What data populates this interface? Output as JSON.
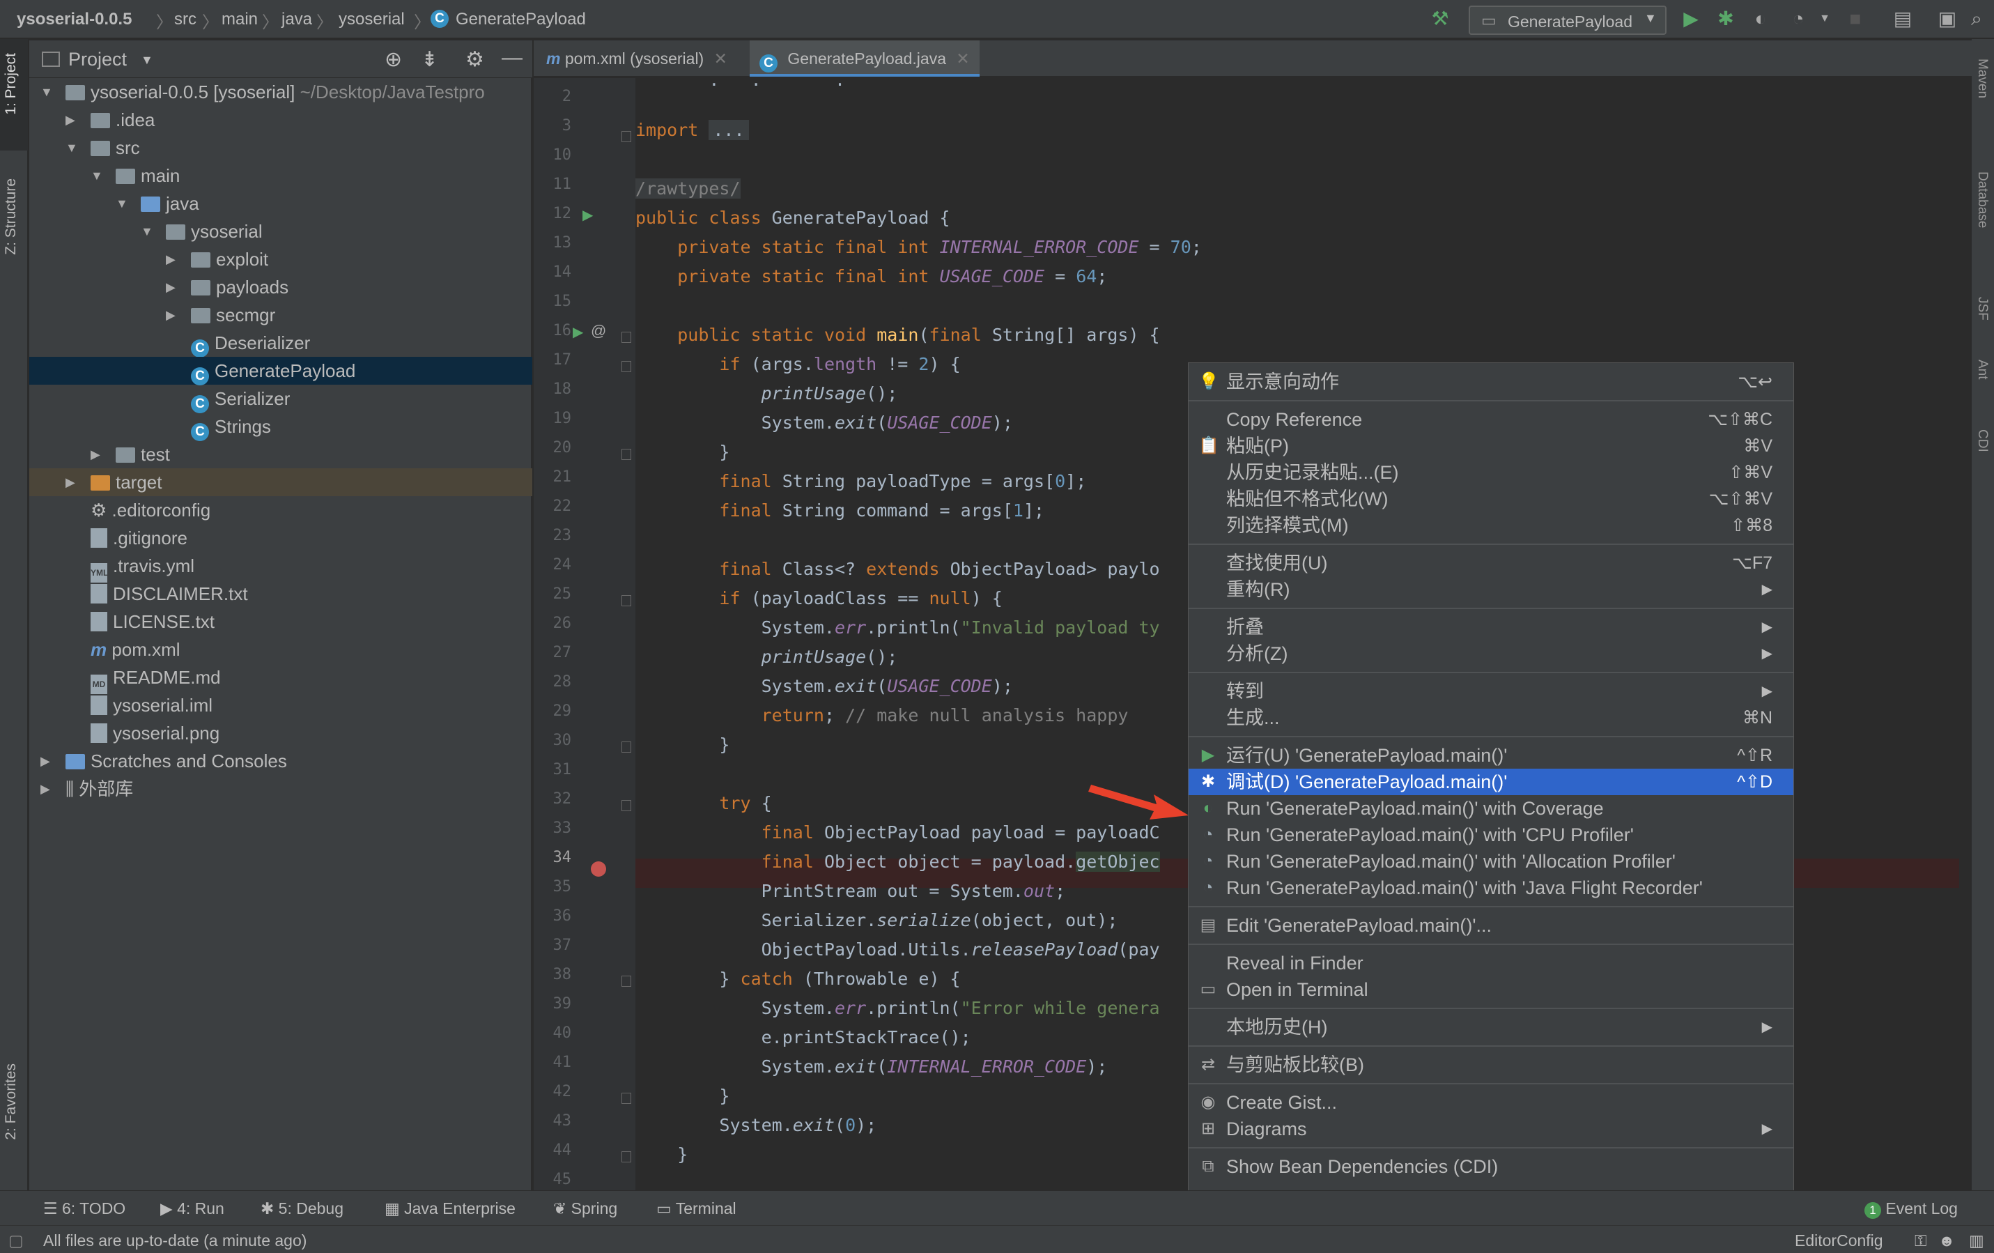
{
  "navbar": {
    "crumbs": [
      "ysoserial-0.0.5",
      "src",
      "main",
      "java",
      "ysoserial",
      "GeneratePayload"
    ],
    "run_config": "GeneratePayload"
  },
  "left_strip": {
    "project": "1: Project",
    "structure": "Z: Structure",
    "favorites": "2: Favorites"
  },
  "right_strip": {
    "maven": "Maven",
    "database": "Database",
    "jsf": "JSF",
    "ant": "Ant",
    "cdi": "CDI"
  },
  "project_panel": {
    "title": "Project",
    "tree": [
      {
        "label": "ysoserial-0.0.5 [ysoserial]",
        "extra": "~/Desktop/JavaTestpro",
        "depth": 0,
        "arrow": "down",
        "icon": "folder"
      },
      {
        "label": ".idea",
        "depth": 1,
        "arrow": "right",
        "icon": "folder"
      },
      {
        "label": "src",
        "depth": 1,
        "arrow": "down",
        "icon": "folder"
      },
      {
        "label": "main",
        "depth": 2,
        "arrow": "down",
        "icon": "folder"
      },
      {
        "label": "java",
        "depth": 3,
        "arrow": "down",
        "icon": "folder-blue"
      },
      {
        "label": "ysoserial",
        "depth": 4,
        "arrow": "down",
        "icon": "package"
      },
      {
        "label": "exploit",
        "depth": 5,
        "arrow": "right",
        "icon": "package"
      },
      {
        "label": "payloads",
        "depth": 5,
        "arrow": "right",
        "icon": "package"
      },
      {
        "label": "secmgr",
        "depth": 5,
        "arrow": "right",
        "icon": "package"
      },
      {
        "label": "Deserializer",
        "depth": 5,
        "arrow": "",
        "icon": "class"
      },
      {
        "label": "GeneratePayload",
        "depth": 5,
        "arrow": "",
        "icon": "class",
        "selected": true
      },
      {
        "label": "Serializer",
        "depth": 5,
        "arrow": "",
        "icon": "class"
      },
      {
        "label": "Strings",
        "depth": 5,
        "arrow": "",
        "icon": "class"
      },
      {
        "label": "test",
        "depth": 2,
        "arrow": "right",
        "icon": "folder"
      },
      {
        "label": "target",
        "depth": 1,
        "arrow": "right",
        "icon": "folder-orange",
        "target": true
      },
      {
        "label": ".editorconfig",
        "depth": 1,
        "arrow": "",
        "icon": "gear-file"
      },
      {
        "label": ".gitignore",
        "depth": 1,
        "arrow": "",
        "icon": "file"
      },
      {
        "label": ".travis.yml",
        "depth": 1,
        "arrow": "",
        "icon": "yml-file"
      },
      {
        "label": "DISCLAIMER.txt",
        "depth": 1,
        "arrow": "",
        "icon": "file"
      },
      {
        "label": "LICENSE.txt",
        "depth": 1,
        "arrow": "",
        "icon": "file"
      },
      {
        "label": "pom.xml",
        "depth": 1,
        "arrow": "",
        "icon": "maven-file"
      },
      {
        "label": "README.md",
        "depth": 1,
        "arrow": "",
        "icon": "md-file"
      },
      {
        "label": "ysoserial.iml",
        "depth": 1,
        "arrow": "",
        "icon": "file"
      },
      {
        "label": "ysoserial.png",
        "depth": 1,
        "arrow": "",
        "icon": "file"
      },
      {
        "label": "Scratches and Consoles",
        "depth": 0,
        "arrow": "right",
        "icon": "scratch"
      },
      {
        "label": "外部库",
        "depth": 0,
        "arrow": "right",
        "icon": "library"
      }
    ]
  },
  "tabs": [
    {
      "label": "pom.xml (ysoserial)",
      "icon": "m",
      "active": false
    },
    {
      "label": "GeneratePayload.java",
      "icon": "c",
      "active": true
    }
  ],
  "line_numbers": [
    "2",
    "3",
    "10",
    "11",
    "12",
    "13",
    "14",
    "15",
    "16",
    "17",
    "18",
    "19",
    "20",
    "21",
    "22",
    "23",
    "24",
    "25",
    "26",
    "27",
    "28",
    "29",
    "30",
    "31",
    "32",
    "33",
    "34",
    "35",
    "36",
    "37",
    "38",
    "39",
    "40",
    "41",
    "42",
    "43",
    "44",
    "45"
  ],
  "context_menu": {
    "items": [
      {
        "label": "显示意向动作",
        "shortcut": "⌥↩",
        "icon": "bulb"
      },
      {
        "sep": true
      },
      {
        "label": "Copy Reference",
        "shortcut": "⌥⇧⌘C"
      },
      {
        "label": "粘贴(P)",
        "shortcut": "⌘V",
        "icon": "clipboard"
      },
      {
        "label": "从历史记录粘贴...(E)",
        "shortcut": "⇧⌘V"
      },
      {
        "label": "粘贴但不格式化(W)",
        "shortcut": "⌥⇧⌘V"
      },
      {
        "label": "列选择模式(M)",
        "shortcut": "⇧⌘8"
      },
      {
        "sep": true
      },
      {
        "label": "查找使用(U)",
        "shortcut": "⌥F7"
      },
      {
        "label": "重构(R)",
        "submenu": true
      },
      {
        "sep": true
      },
      {
        "label": "折叠",
        "submenu": true
      },
      {
        "label": "分析(Z)",
        "submenu": true
      },
      {
        "sep": true
      },
      {
        "label": "转到",
        "submenu": true
      },
      {
        "label": "生成...",
        "shortcut": "⌘N"
      },
      {
        "sep": true
      },
      {
        "label": "运行(U) 'GeneratePayload.main()'",
        "shortcut": "^⇧R",
        "icon": "run"
      },
      {
        "label": "调试(D) 'GeneratePayload.main()'",
        "shortcut": "^⇧D",
        "icon": "debug",
        "highlighted": true
      },
      {
        "label": "Run 'GeneratePayload.main()' with Coverage",
        "icon": "coverage"
      },
      {
        "label": "Run 'GeneratePayload.main()' with 'CPU Profiler'",
        "icon": "profiler"
      },
      {
        "label": "Run 'GeneratePayload.main()' with 'Allocation Profiler'",
        "icon": "profiler"
      },
      {
        "label": "Run 'GeneratePayload.main()' with 'Java Flight Recorder'",
        "icon": "profiler"
      },
      {
        "sep": true
      },
      {
        "label": "Edit 'GeneratePayload.main()'...",
        "icon": "edit"
      },
      {
        "sep": true
      },
      {
        "label": "Reveal in Finder"
      },
      {
        "label": "Open in Terminal",
        "icon": "terminal"
      },
      {
        "sep": true
      },
      {
        "label": "本地历史(H)",
        "submenu": true
      },
      {
        "sep": true
      },
      {
        "label": "与剪贴板比较(B)",
        "icon": "compare"
      },
      {
        "sep": true
      },
      {
        "label": "Create Gist...",
        "icon": "github"
      },
      {
        "label": "Diagrams",
        "submenu": true,
        "icon": "diagram"
      },
      {
        "sep": true
      },
      {
        "label": "Show Bean Dependencies (CDI)",
        "icon": "cdi"
      }
    ]
  },
  "tool_windows": [
    {
      "label": "6: TODO",
      "icon": "list"
    },
    {
      "label": "4: Run",
      "icon": "run"
    },
    {
      "label": "5: Debug",
      "icon": "bug"
    },
    {
      "label": "Java Enterprise",
      "icon": "enterprise"
    },
    {
      "label": "Spring",
      "icon": "spring"
    },
    {
      "label": "Terminal",
      "icon": "terminal"
    }
  ],
  "event_log": {
    "count": "1",
    "label": "Event Log"
  },
  "status": {
    "message": "All files are up-to-date (a minute ago)",
    "editorconfig": "EditorConfig"
  },
  "colors": {
    "accent": "#2f65ca",
    "selection": "#0d293e",
    "breakpoint": "#c75450",
    "arrow": "#e8412b"
  }
}
